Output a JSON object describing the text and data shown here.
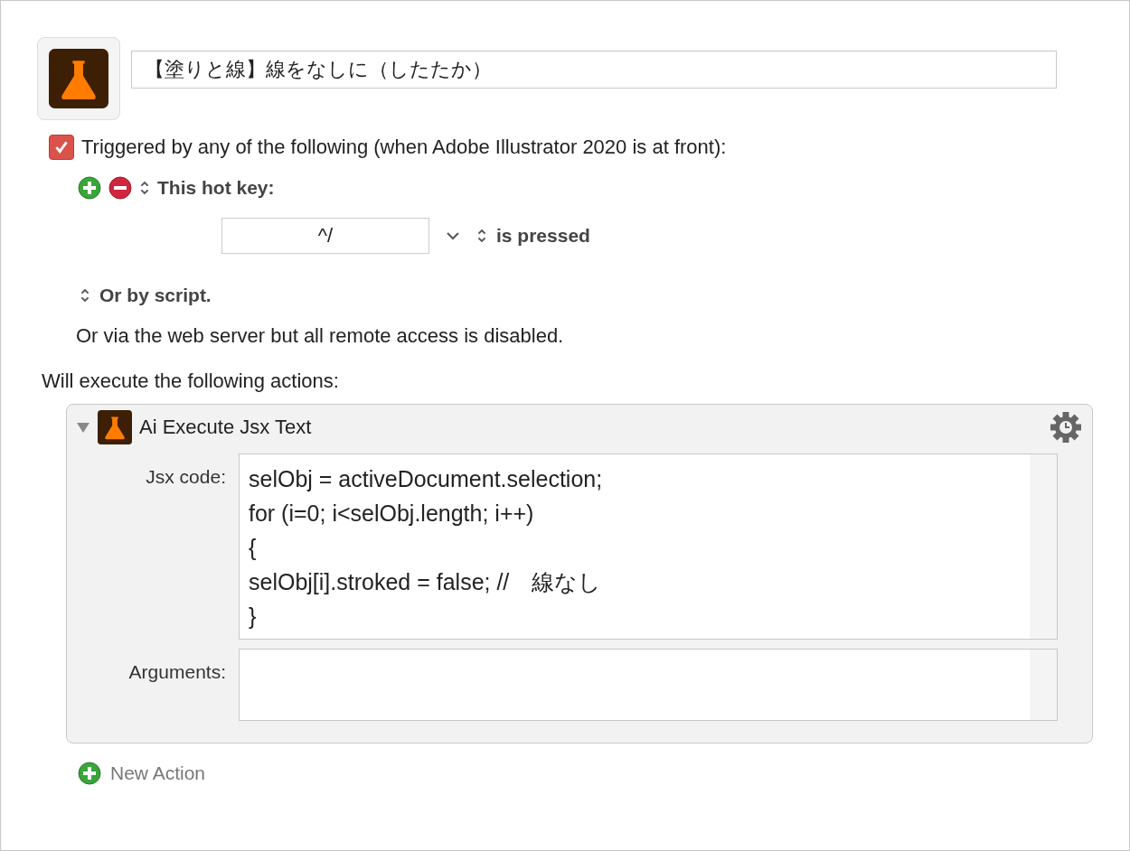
{
  "macro": {
    "name": "【塗りと線】線をなしに（したたか）"
  },
  "trigger": {
    "checked": true,
    "label": "Triggered by any of the following (when Adobe Illustrator 2020 is at front):"
  },
  "hot_key": {
    "label": "This hot key:",
    "value": "^/",
    "condition": "is pressed"
  },
  "script_trigger": {
    "label": "Or by script."
  },
  "web_server_note": "Or via the web server but all remote access is disabled.",
  "actions_heading": "Will execute the following actions:",
  "actions": [
    {
      "title": "Ai Execute Jsx Text",
      "expanded": true,
      "code_label": "Jsx code:",
      "code_lines": [
        "selObj = activeDocument.selection;",
        "for (i=0; i<selObj.length; i++)",
        "{",
        "selObj[i].stroked = false; //　線なし",
        "}"
      ],
      "arguments_label": "Arguments:"
    }
  ],
  "new_action": "New Action"
}
